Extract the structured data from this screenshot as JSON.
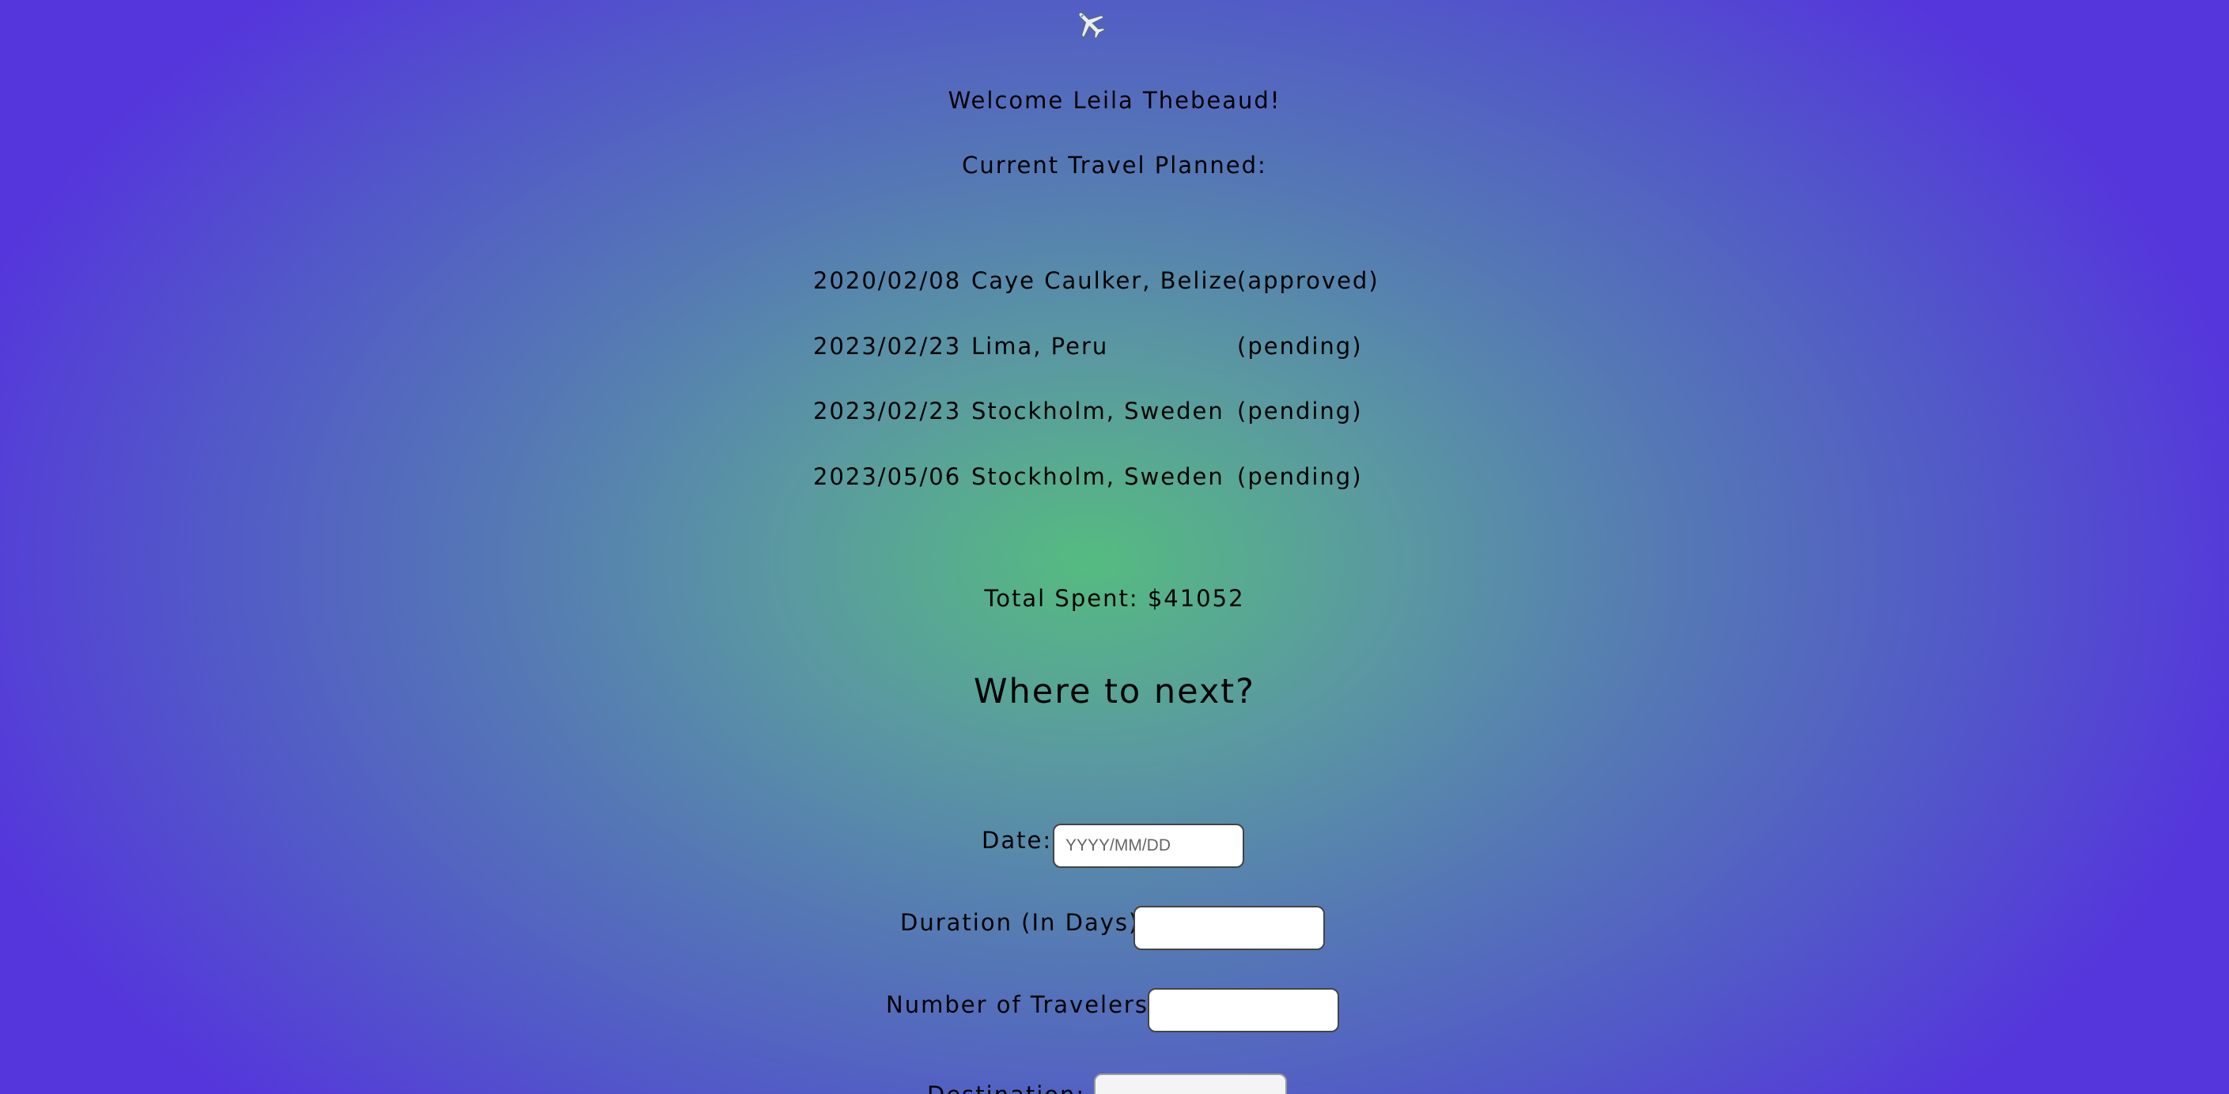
{
  "header": {
    "icon": "airplane-icon",
    "welcome": "Welcome Leila Thebeaud!",
    "current_label": "Current Travel Planned:"
  },
  "trips": [
    {
      "date": "2020/02/08",
      "destination": "Caye Caulker, Belize",
      "status": "(approved)"
    },
    {
      "date": "2023/02/23",
      "destination": "Lima, Peru",
      "status": "(pending)"
    },
    {
      "date": "2023/02/23",
      "destination": "Stockholm, Sweden",
      "status": "(pending)"
    },
    {
      "date": "2023/05/06",
      "destination": "Stockholm, Sweden",
      "status": "(pending)"
    }
  ],
  "total_spent": "Total Spent: $41052",
  "form": {
    "heading": "Where to next?",
    "date_label": "Date:",
    "date_placeholder": "YYYY/MM/DD",
    "date_value": "",
    "duration_label": "Duration (In Days):",
    "duration_value": "",
    "travelers_label": "Number of Travelers:",
    "travelers_value": "",
    "destination_label": "Destination:"
  }
}
